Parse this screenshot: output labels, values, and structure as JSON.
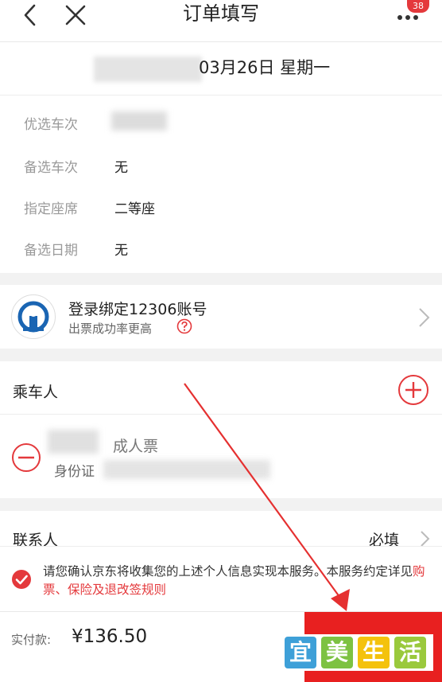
{
  "header": {
    "title": "订单填写",
    "badge": "38",
    "icons": [
      "back-arrow-icon",
      "close-icon",
      "more-icon"
    ]
  },
  "trip": {
    "date": "03月26日 星期一"
  },
  "info": {
    "rows": [
      {
        "label": "优选车次",
        "value": ""
      },
      {
        "label": "备选车次",
        "value": "无"
      },
      {
        "label": "指定座席",
        "value": "二等座"
      },
      {
        "label": "备选日期",
        "value": "无"
      }
    ]
  },
  "login": {
    "title": "登录绑定12306账号",
    "subtitle": "出票成功率更高"
  },
  "passenger": {
    "title": "乘车人",
    "ticket_type": "成人票",
    "id_label": "身份证"
  },
  "contact": {
    "title": "联系人",
    "required": "必填"
  },
  "consent": {
    "text": "请您确认京东将收集您的上述个人信息实现本服务。本服务约定详见",
    "link": "购票、保险及退改签规则"
  },
  "payment": {
    "label": "实付款:",
    "amount": "¥136.50"
  },
  "watermark": {
    "chars": [
      "宜",
      "美",
      "生",
      "活"
    ]
  },
  "colors": {
    "accent_red": "#e4393c",
    "submit_red": "#e82020",
    "annotation_arrow": "#e53030",
    "watermark": [
      "#3ea0d8",
      "#7dc242",
      "#f4c20d",
      "#9ac93c"
    ]
  }
}
